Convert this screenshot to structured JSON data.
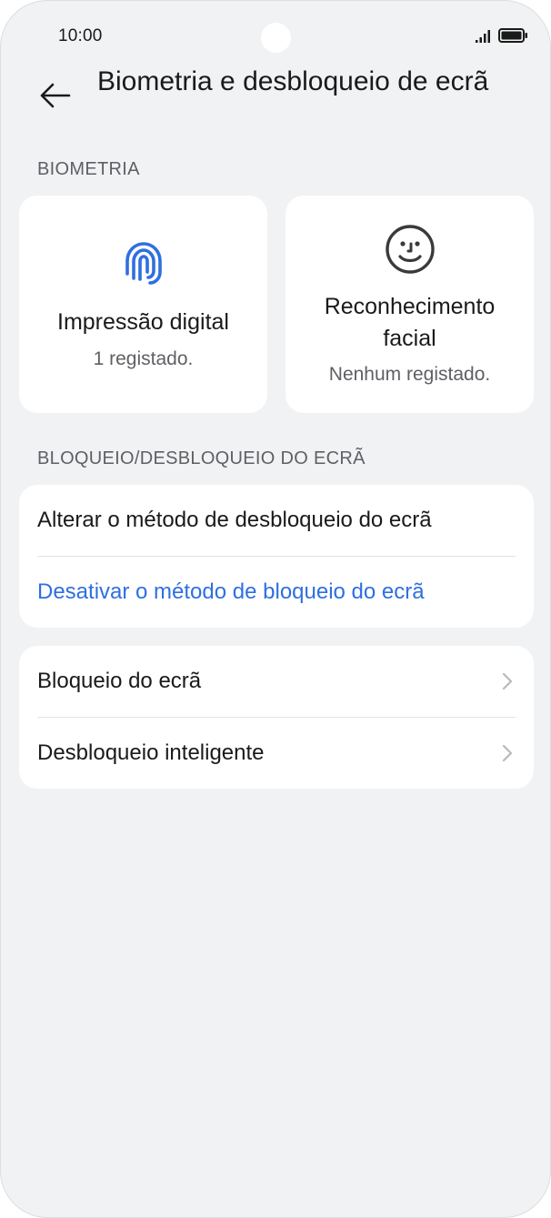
{
  "status_bar": {
    "time": "10:00"
  },
  "header": {
    "title": "Biometria e desbloqueio de ecrã"
  },
  "biometrics": {
    "section_label": "BIOMETRIA",
    "fingerprint": {
      "title": "Impressão digital",
      "status": "1 registado.",
      "icon": "fingerprint-icon",
      "icon_color": "#2f6fe0"
    },
    "face": {
      "title": "Reconhecimento facial",
      "status": "Nenhum registado.",
      "icon": "face-icon"
    }
  },
  "lock_section": {
    "section_label": "BLOQUEIO/DESBLOQUEIO DO ECRÃ",
    "change_method": "Alterar o método de desbloqueio do ecrã",
    "disable_method": "Desativar o método de bloqueio do ecrã",
    "disable_color": "#2f6fe0"
  },
  "more_settings": {
    "items": [
      {
        "label": "Bloqueio do ecrã"
      },
      {
        "label": "Desbloqueio inteligente"
      }
    ]
  }
}
